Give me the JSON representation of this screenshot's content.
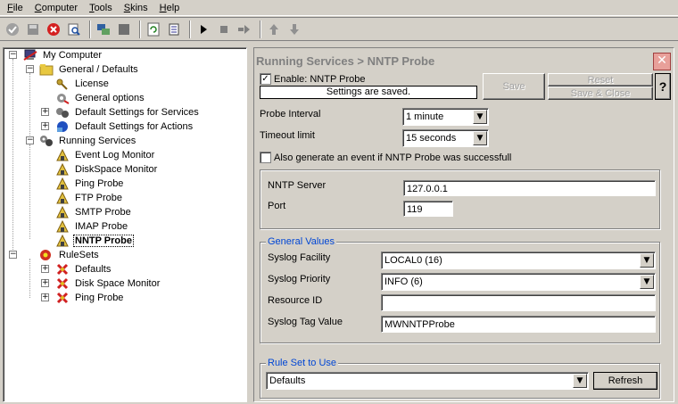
{
  "menu": [
    {
      "label": "File",
      "underline": "F",
      "rest": "ile"
    },
    {
      "label": "Computer",
      "underline": "C",
      "rest": "omputer"
    },
    {
      "label": "Tools",
      "underline": "T",
      "rest": "ools"
    },
    {
      "label": "Skins",
      "underline": "S",
      "rest": "kins"
    },
    {
      "label": "Help",
      "underline": "H",
      "rest": "elp"
    }
  ],
  "toolbar_icons": [
    "check-icon",
    "save-icon",
    "stop-icon",
    "search-icon",
    "network-icon",
    "window-icon",
    "refresh-icon",
    "config-icon",
    "play-icon",
    "stop-square-icon",
    "step-icon",
    "arrow-up-icon",
    "arrow-down-icon"
  ],
  "tree": {
    "root": "My Computer",
    "general": "General / Defaults",
    "license": "License",
    "general_options": "General options",
    "default_services": "Default Settings for Services",
    "default_actions": "Default Settings for Actions",
    "running_services": "Running Services",
    "event_log": "Event Log Monitor",
    "diskspace": "DiskSpace Monitor",
    "ping": "Ping Probe",
    "ftp": "FTP Probe",
    "smtp": "SMTP Probe",
    "imap": "IMAP Probe",
    "nntp": "NNTP Probe",
    "rulesets": "RuleSets",
    "rs_defaults": "Defaults",
    "rs_disk": "Disk Space Monitor",
    "rs_ping": "Ping Probe"
  },
  "panel": {
    "title": "Running Services > NNTP Probe",
    "enable_label": "Enable: NNTP Probe",
    "status": "Settings are saved.",
    "save": "Save",
    "reset": "Reset",
    "save_close": "Save & Close",
    "help": "?",
    "probe_interval_label": "Probe Interval",
    "probe_interval_value": "1 minute",
    "timeout_label": "Timeout limit",
    "timeout_value": "15 seconds",
    "also_event_label": "Also generate an event if NNTP Probe was successfull",
    "server_label": "NNTP Server",
    "server_value": "127.0.0.1",
    "port_label": "Port",
    "port_value": "119",
    "general_values_title": "General Values",
    "facility_label": "Syslog Facility",
    "facility_value": "LOCAL0 (16)",
    "priority_label": "Syslog Priority",
    "priority_value": "INFO (6)",
    "resource_label": "Resource ID",
    "resource_value": "",
    "tag_label": "Syslog Tag Value",
    "tag_value": "MWNNTPProbe",
    "ruleset_title": "Rule Set to Use",
    "ruleset_value": "Defaults",
    "refresh": "Refresh"
  },
  "colors": {
    "accent": "#0046d5",
    "selection_border": "#000000"
  }
}
